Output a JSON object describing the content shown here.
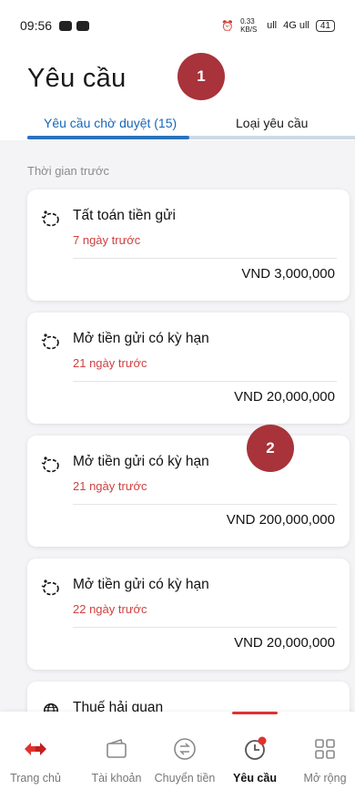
{
  "status_bar": {
    "time": "09:56",
    "net_speed": "0.33 KB/S",
    "signal_1": "ull",
    "signal_2": "4G ull",
    "battery": "41"
  },
  "header": {
    "title": "Yêu cầu",
    "annotation_badge": "1"
  },
  "tabs": [
    {
      "label": "Yêu cầu chờ duyệt (15)",
      "active": true
    },
    {
      "label": "Loại yêu cầu",
      "active": false
    }
  ],
  "section_label": "Thời gian trước",
  "annotation_badge_2": "2",
  "requests": [
    {
      "icon": "piggy-bank-icon",
      "title": "Tất toán tiền gửi",
      "time_ago": "7 ngày trước",
      "amount": "VND 3,000,000"
    },
    {
      "icon": "piggy-bank-icon",
      "title": "Mở tiền gửi có kỳ hạn",
      "time_ago": "21 ngày trước",
      "amount": "VND 20,000,000"
    },
    {
      "icon": "piggy-bank-icon",
      "title": "Mở tiền gửi có kỳ hạn",
      "time_ago": "21 ngày trước",
      "amount": "VND 200,000,000"
    },
    {
      "icon": "piggy-bank-icon",
      "title": "Mở tiền gửi có kỳ hạn",
      "time_ago": "22 ngày trước",
      "amount": "VND 20,000,000"
    },
    {
      "icon": "globe-icon",
      "title": "Thuế hải quan"
    }
  ],
  "bottom_nav": [
    {
      "icon": "home-logo-icon",
      "label": "Trang chủ",
      "active": false
    },
    {
      "icon": "wallet-icon",
      "label": "Tài khoản",
      "active": false
    },
    {
      "icon": "transfer-icon",
      "label": "Chuyển tiền",
      "active": false
    },
    {
      "icon": "clock-icon",
      "label": "Yêu cầu",
      "active": true
    },
    {
      "icon": "grid-icon",
      "label": "Mở rộng",
      "active": false
    }
  ],
  "colors": {
    "accent_blue": "#2b72be",
    "alert_red": "#d04040",
    "badge_red": "#a8333a",
    "brand_red": "#e0322d"
  }
}
